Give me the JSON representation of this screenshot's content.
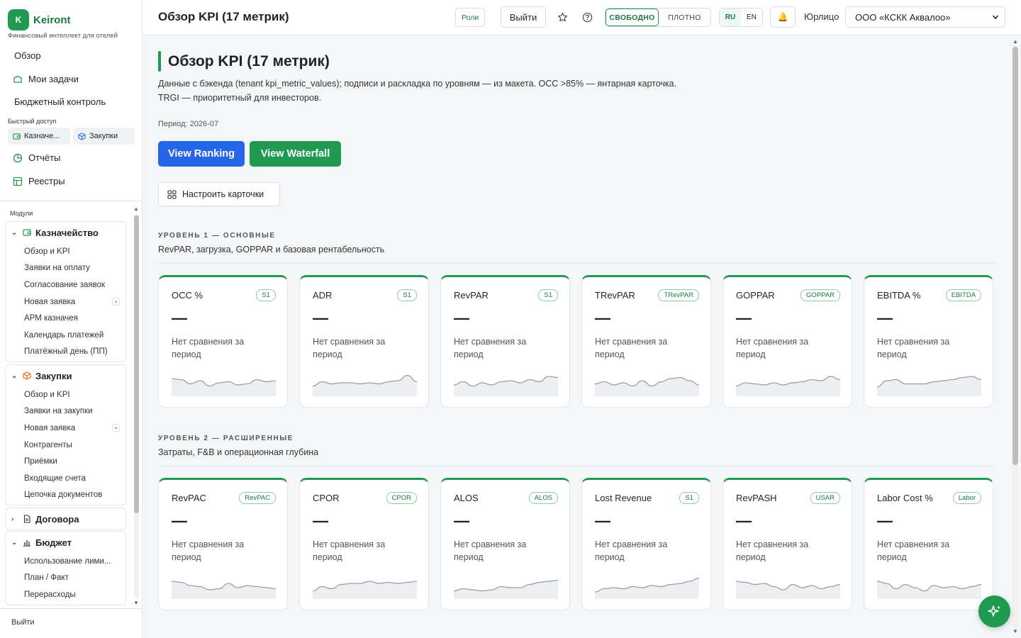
{
  "brand": {
    "logo_letter": "K",
    "name": "Keiront",
    "subtitle": "Финансовый интеллект для отелей"
  },
  "sidebar": {
    "nav": [
      {
        "label": "Обзор",
        "icon": ""
      },
      {
        "label": "Мои задачи",
        "icon": "tasks-icon"
      },
      {
        "label": "Бюджетный контроль",
        "icon": ""
      }
    ],
    "quick_access_label": "Быстрый доступ",
    "quick_access": [
      {
        "label": "Казначе...",
        "icon": "wallet-icon"
      },
      {
        "label": "Закупки",
        "icon": "box-icon"
      }
    ],
    "nav2": [
      {
        "label": "Отчёты",
        "icon": "pie-chart-icon"
      },
      {
        "label": "Реестры",
        "icon": "table-icon"
      }
    ],
    "modules_label": "Модули",
    "groups": [
      {
        "title": "Казначейство",
        "expanded": true,
        "icon": "wallet-icon",
        "items": [
          {
            "label": "Обзор и KPI"
          },
          {
            "label": "Заявки на оплату"
          },
          {
            "label": "Согласование заявок"
          },
          {
            "label": "Новая заявка",
            "plus": "+"
          },
          {
            "label": "АРМ казначея"
          },
          {
            "label": "Календарь платежей"
          },
          {
            "label": "Платёжный день (ПП)"
          }
        ]
      },
      {
        "title": "Закупки",
        "expanded": true,
        "icon": "box-icon",
        "items": [
          {
            "label": "Обзор и KPI"
          },
          {
            "label": "Заявки на закупки"
          },
          {
            "label": "Новая заявка",
            "plus": "+"
          },
          {
            "label": "Контрагенты"
          },
          {
            "label": "Приёмки"
          },
          {
            "label": "Входящие счета"
          },
          {
            "label": "Цепочка документов"
          }
        ]
      },
      {
        "title": "Договора",
        "expanded": false,
        "icon": "document-icon",
        "items": []
      },
      {
        "title": "Бюджет",
        "expanded": true,
        "icon": "bar-chart-icon",
        "items": [
          {
            "label": "Использование лими..."
          },
          {
            "label": "План / Факт"
          },
          {
            "label": "Перерасходы"
          }
        ]
      }
    ],
    "logout": "Выйти"
  },
  "topbar": {
    "title": "Обзор KPI (17 метрик)",
    "roles": "Роли",
    "exit": "Выйти",
    "density": [
      "СВОБОДНО",
      "ПЛОТНО"
    ],
    "density_selected": "СВОБОДНО",
    "langs": [
      "RU",
      "EN"
    ],
    "lang_selected": "RU",
    "entity_label": "Юрлицо",
    "entity_value": "ООО «КСКК Аквалоо»"
  },
  "main": {
    "title": "Обзор KPI (17 метрик)",
    "desc_line1": "Данные с бэкенда (tenant kpi_metric_values); подписи и раскладка по уровням — из макета. OCC >85% — янтарная карточка.",
    "desc_line2": "TRGI — приоритетный для инвесторов.",
    "period": "Период: 2026-07",
    "btn_ranking": "View Ranking",
    "btn_waterfall": "View Waterfall",
    "btn_configure": "Настроить карточки",
    "levels": [
      {
        "title": "УРОВЕНЬ 1 — ОСНОВНЫЕ",
        "subtitle": "RevPAR, загрузка, GOPPAR и базовая рентабельность",
        "cards": [
          {
            "name": "OCC %",
            "tag": "S1",
            "value": "—",
            "compare": "Нет сравнения за период",
            "spark": [
              0.7,
              0.65,
              0.45,
              0.6,
              0.35,
              0.5,
              0.55,
              0.4,
              0.45,
              0.65,
              0.55,
              0.6
            ]
          },
          {
            "name": "ADR",
            "tag": "S1",
            "value": "—",
            "compare": "Нет сравнения за период",
            "spark": [
              0.35,
              0.55,
              0.45,
              0.5,
              0.5,
              0.45,
              0.5,
              0.45,
              0.55,
              0.6,
              0.85,
              0.55
            ]
          },
          {
            "name": "RevPAR",
            "tag": "S1",
            "value": "—",
            "compare": "Нет сравнения за период",
            "spark": [
              0.4,
              0.55,
              0.35,
              0.5,
              0.4,
              0.55,
              0.6,
              0.5,
              0.65,
              0.55,
              0.8,
              0.75
            ]
          },
          {
            "name": "TRevPAR",
            "tag": "TRevPAR",
            "value": "—",
            "compare": "Нет сравнения за период",
            "spark": [
              0.45,
              0.55,
              0.4,
              0.5,
              0.35,
              0.6,
              0.35,
              0.55,
              0.7,
              0.75,
              0.6,
              0.4
            ]
          },
          {
            "name": "GOPPAR",
            "tag": "GOPPAR",
            "value": "—",
            "compare": "Нет сравнения за период",
            "spark": [
              0.35,
              0.5,
              0.45,
              0.4,
              0.5,
              0.4,
              0.5,
              0.55,
              0.65,
              0.6,
              0.8,
              0.65
            ]
          },
          {
            "name": "EBITDA %",
            "tag": "EBITDA",
            "value": "—",
            "compare": "Нет сравнения за период",
            "spark": [
              0.3,
              0.6,
              0.65,
              0.45,
              0.45,
              0.45,
              0.55,
              0.6,
              0.65,
              0.75,
              0.8,
              0.65
            ]
          }
        ]
      },
      {
        "title": "УРОВЕНЬ 2 — РАСШИРЕННЫЕ",
        "subtitle": "Затраты, F&B и операционная глубина",
        "cards": [
          {
            "name": "RevPAC",
            "tag": "RevPAC",
            "value": "—",
            "compare": "Нет сравнения за период",
            "spark": [
              0.7,
              0.65,
              0.5,
              0.45,
              0.3,
              0.35,
              0.6,
              0.4,
              0.5,
              0.45,
              0.4,
              0.35
            ]
          },
          {
            "name": "CPOR",
            "tag": "CPOR",
            "value": "—",
            "compare": "Нет сравнения за период",
            "spark": [
              0.25,
              0.45,
              0.35,
              0.55,
              0.6,
              0.6,
              0.7,
              0.6,
              0.65,
              0.6,
              0.65,
              0.7
            ]
          },
          {
            "name": "ALOS",
            "tag": "ALOS",
            "value": "—",
            "compare": "Нет сравнения за период",
            "spark": [
              0.25,
              0.35,
              0.3,
              0.25,
              0.3,
              0.45,
              0.4,
              0.4,
              0.55,
              0.65,
              0.7,
              0.75
            ]
          },
          {
            "name": "Lost Revenue",
            "tag": "S1",
            "value": "—",
            "compare": "Нет сравнения за период",
            "spark": [
              0.2,
              0.35,
              0.4,
              0.35,
              0.45,
              0.4,
              0.5,
              0.45,
              0.55,
              0.6,
              0.7,
              0.85
            ]
          },
          {
            "name": "RevPASH",
            "tag": "USAR",
            "value": "—",
            "compare": "Нет сравнения за период",
            "spark": [
              0.7,
              0.65,
              0.55,
              0.6,
              0.45,
              0.3,
              0.55,
              0.4,
              0.5,
              0.35,
              0.45,
              0.55
            ]
          },
          {
            "name": "Labor Cost %",
            "tag": "Labor",
            "value": "—",
            "compare": "Нет сравнения за период",
            "spark": [
              0.7,
              0.6,
              0.35,
              0.55,
              0.4,
              0.25,
              0.5,
              0.4,
              0.45,
              0.35,
              0.45,
              0.55
            ]
          }
        ]
      }
    ]
  },
  "colors": {
    "accent": "#1f9a50",
    "primary": "#2566e8",
    "sparkline": "#9a9fa6"
  }
}
